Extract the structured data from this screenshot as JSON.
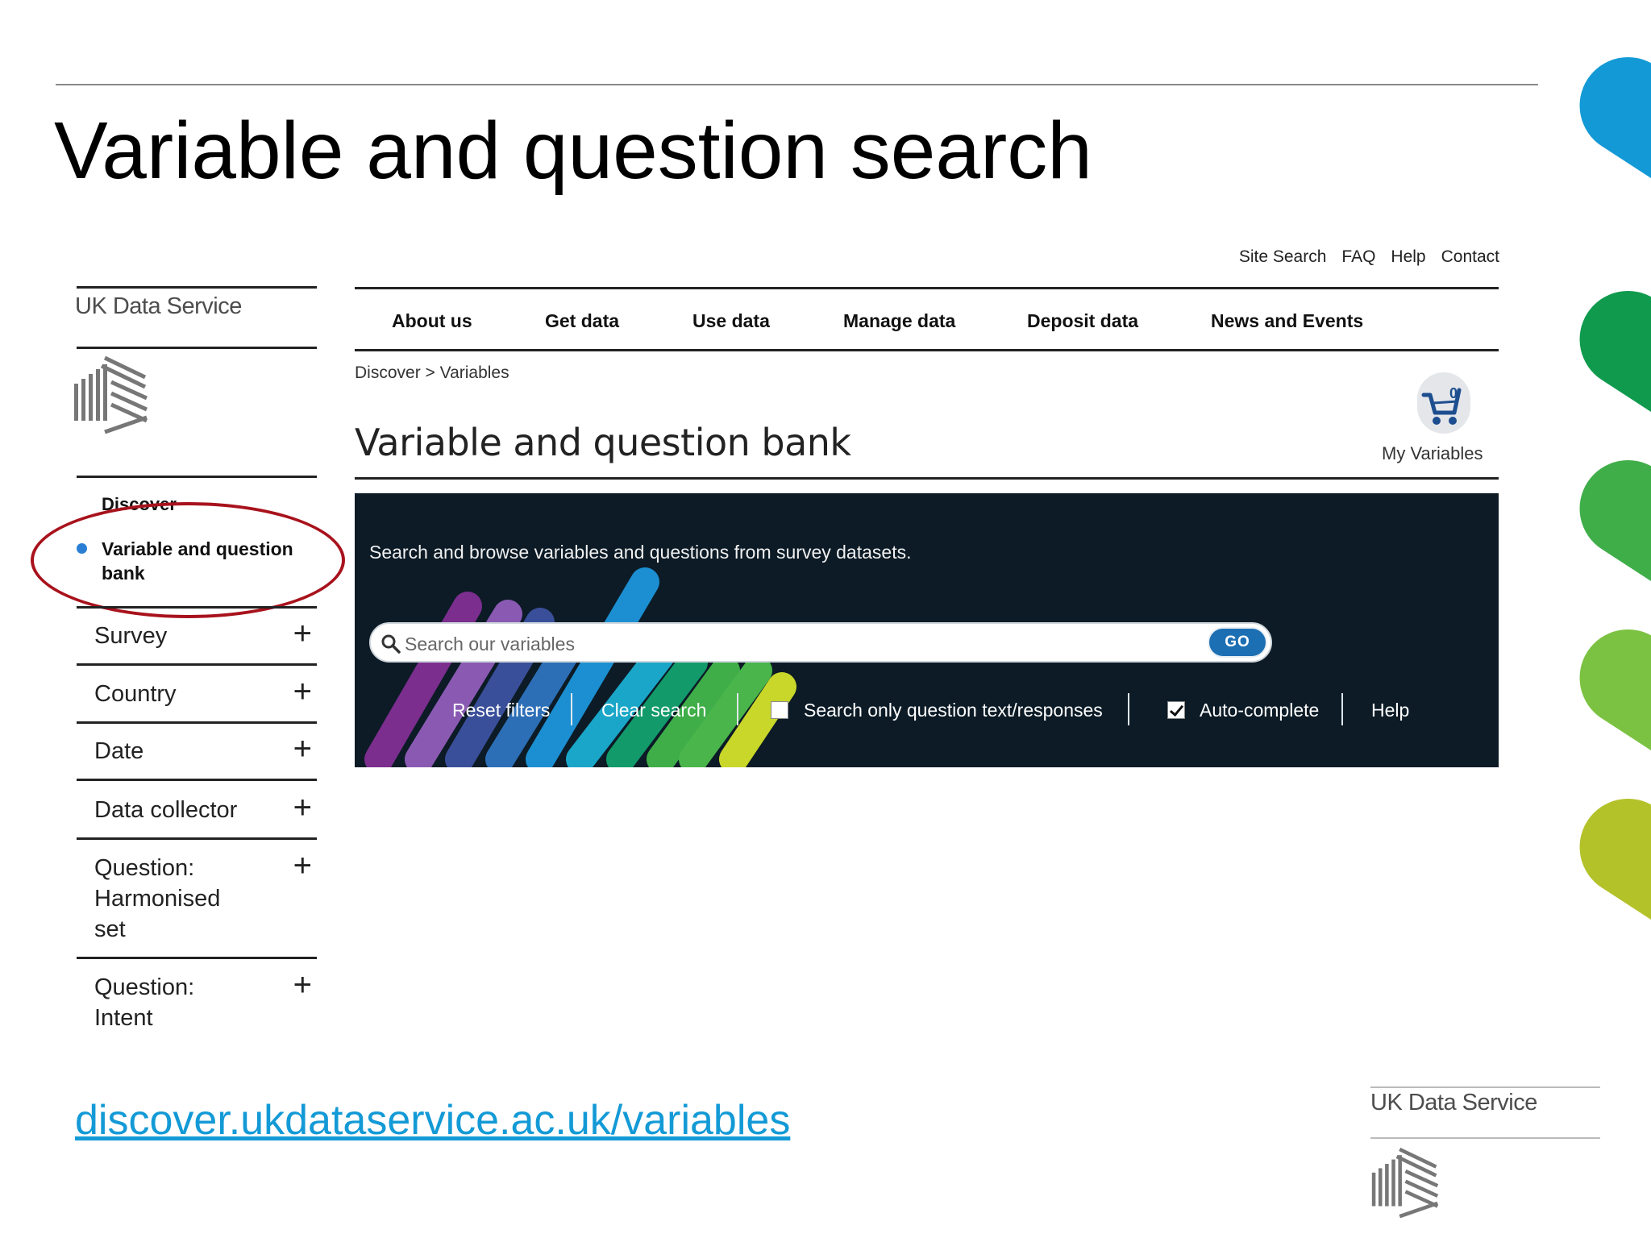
{
  "slide": {
    "title": "Variable and question search",
    "link": "discover.ukdataservice.ac.uk/variables",
    "footer_brand": "UK Data Service",
    "accent_colors": [
      "#139ad6",
      "#0f9a4e",
      "#3fae49",
      "#7cc242",
      "#b4c22a"
    ]
  },
  "utility_nav": [
    "Site Search",
    "FAQ",
    "Help",
    "Contact"
  ],
  "sidebar": {
    "brand": "UK Data Service",
    "section": "Discover",
    "active_item": "Variable and question bank",
    "facets": [
      {
        "label": "Survey",
        "icon": "plus-icon"
      },
      {
        "label": "Country",
        "icon": "plus-icon"
      },
      {
        "label": "Date",
        "icon": "plus-icon"
      },
      {
        "label": "Data collector",
        "icon": "plus-icon"
      },
      {
        "label": "Question: Harmonised set",
        "icon": "plus-icon"
      },
      {
        "label": "Question: Intent",
        "icon": "plus-icon"
      }
    ]
  },
  "main_nav": [
    "About us",
    "Get data",
    "Use data",
    "Manage data",
    "Deposit data",
    "News and Events"
  ],
  "breadcrumb": "Discover > Variables",
  "page": {
    "heading": "Variable and question bank",
    "cart_count": "0",
    "cart_label": "My Variables"
  },
  "search": {
    "intro": "Search and browse variables and questions from survey datasets.",
    "placeholder": "Search our variables",
    "go_label": "GO",
    "options": {
      "reset": "Reset filters",
      "clear": "Clear search",
      "question_only": "Search only question text/responses",
      "question_only_checked": false,
      "autocomplete": "Auto-complete",
      "autocomplete_checked": true,
      "help": "Help"
    }
  }
}
